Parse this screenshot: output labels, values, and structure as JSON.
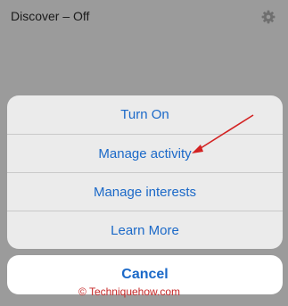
{
  "header": {
    "title": "Discover – Off",
    "settings_icon": "gear-icon"
  },
  "action_sheet": {
    "items": [
      {
        "label": "Turn On"
      },
      {
        "label": "Manage activity"
      },
      {
        "label": "Manage interests"
      },
      {
        "label": "Learn More"
      }
    ],
    "cancel_label": "Cancel"
  },
  "watermark": {
    "text": "© Techniquehow.com"
  },
  "colors": {
    "accent": "#1b69c8",
    "backdrop": "#9b9b9b",
    "sheet_bg": "#ebebeb",
    "annotation": "#c62828"
  }
}
